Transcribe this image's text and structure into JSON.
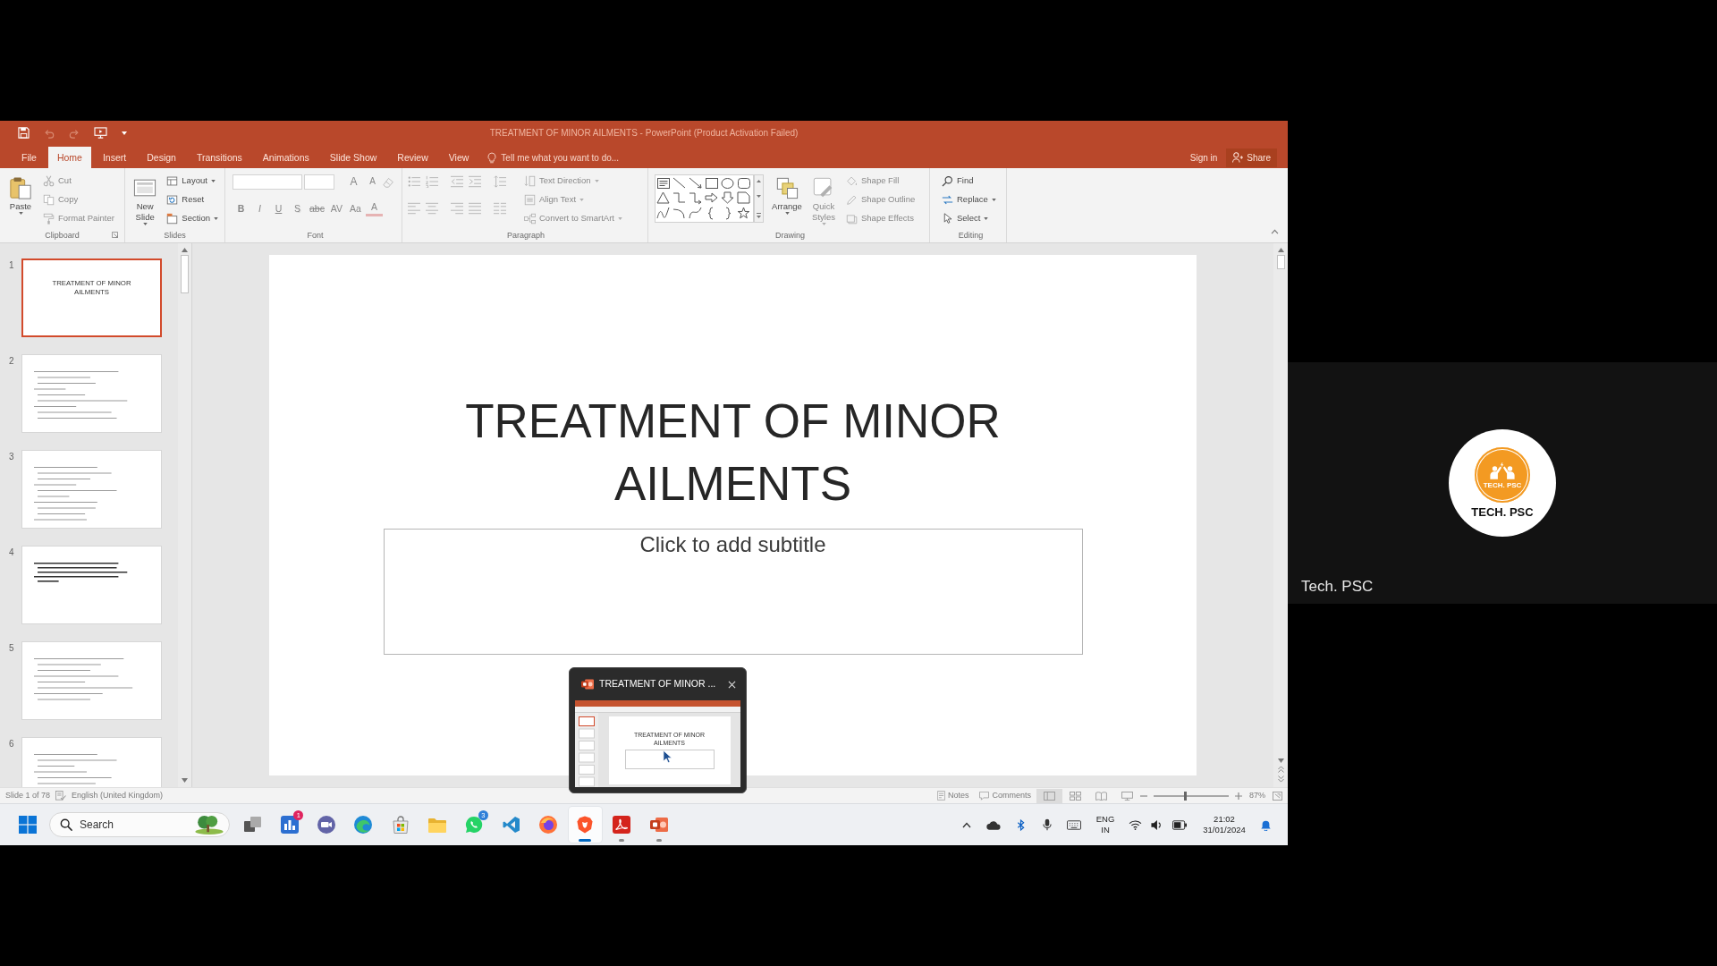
{
  "powerpoint": {
    "title_bar": {
      "title": "TREATMENT OF MINOR AILMENTS - PowerPoint (Product Activation Failed)"
    },
    "tabs": [
      {
        "label": "File",
        "selected": false
      },
      {
        "label": "Home",
        "selected": true
      },
      {
        "label": "Insert",
        "selected": false
      },
      {
        "label": "Design",
        "selected": false
      },
      {
        "label": "Transitions",
        "selected": false
      },
      {
        "label": "Animations",
        "selected": false
      },
      {
        "label": "Slide Show",
        "selected": false
      },
      {
        "label": "Review",
        "selected": false
      },
      {
        "label": "View",
        "selected": false
      }
    ],
    "tell_me": {
      "placeholder": "Tell me what you want to do..."
    },
    "account": {
      "sign_in": "Sign in",
      "share": "Share"
    },
    "ribbon": {
      "groups": [
        {
          "kind": "clipboard",
          "label": "Clipboard",
          "items": [
            {
              "kind": "large",
              "label": "Paste",
              "dropdown": true,
              "disabled": false
            },
            {
              "kind": "small",
              "label": "Cut",
              "dropdown": false,
              "disabled": true
            },
            {
              "kind": "small",
              "label": "Copy",
              "dropdown": false,
              "disabled": true
            },
            {
              "kind": "small",
              "label": "Format Painter",
              "dropdown": false,
              "disabled": true
            }
          ]
        },
        {
          "kind": "slides",
          "label": "Slides",
          "items": [
            {
              "kind": "large",
              "label": "New Slide",
              "dropdown": true,
              "disabled": false
            },
            {
              "kind": "small",
              "label": "Layout",
              "dropdown": true,
              "disabled": false
            },
            {
              "kind": "small",
              "label": "Reset",
              "dropdown": false,
              "disabled": false
            },
            {
              "kind": "small",
              "label": "Section",
              "dropdown": true,
              "disabled": false
            }
          ]
        },
        {
          "kind": "font",
          "label": "Font",
          "items": [
            {
              "kind": "font_row",
              "glyphs": [
                "A",
                "A"
              ],
              "disabled": true
            },
            {
              "kind": "format_row",
              "glyphs": [
                "B",
                "I",
                "U",
                "S",
                "abc",
                "AV",
                "Aa",
                "A"
              ],
              "disabled": true
            }
          ]
        },
        {
          "kind": "paragraph",
          "label": "Paragraph",
          "items": [
            {
              "kind": "icon_rows",
              "disabled": true
            },
            {
              "kind": "small",
              "label": "Text Direction",
              "dropdown": true,
              "disabled": true
            },
            {
              "kind": "small",
              "label": "Align Text",
              "dropdown": true,
              "disabled": true
            },
            {
              "kind": "small",
              "label": "Convert to SmartArt",
              "dropdown": true,
              "disabled": true
            }
          ]
        },
        {
          "kind": "drawing",
          "label": "Drawing",
          "items": [
            {
              "kind": "gallery"
            },
            {
              "kind": "large",
              "label": "Arrange",
              "dropdown": true,
              "disabled": false
            },
            {
              "kind": "large",
              "label": "Quick Styles",
              "dropdown": true,
              "disabled": true
            },
            {
              "kind": "small",
              "label": "Shape Fill",
              "dropdown": false,
              "disabled": true
            },
            {
              "kind": "small",
              "label": "Shape Outline",
              "dropdown": false,
              "disabled": true
            },
            {
              "kind": "small",
              "label": "Shape Effects",
              "dropdown": false,
              "disabled": true
            }
          ]
        },
        {
          "kind": "editing",
          "label": "Editing",
          "items": [
            {
              "kind": "small",
              "label": "Find",
              "dropdown": false,
              "disabled": false
            },
            {
              "kind": "small",
              "label": "Replace",
              "dropdown": true,
              "disabled": false
            },
            {
              "kind": "small",
              "label": "Select",
              "dropdown": true,
              "disabled": false
            }
          ]
        }
      ]
    },
    "slides": [
      {
        "number": "1",
        "kind": "title",
        "title": "TREATMENT OF MINOR AILMENTS",
        "selected": true
      },
      {
        "number": "2",
        "kind": "bullets",
        "selected": false
      },
      {
        "number": "3",
        "kind": "bullets",
        "selected": false
      },
      {
        "number": "4",
        "kind": "bullets",
        "selected": false
      },
      {
        "number": "5",
        "kind": "bullets",
        "selected": false
      },
      {
        "number": "6",
        "kind": "bullets",
        "selected": false
      }
    ],
    "slide": {
      "title": "TREATMENT OF MINOR AILMENTS",
      "subtitle": {
        "placeholder": "Click to add subtitle"
      }
    },
    "status_bar": {
      "slide_position": "Slide 1 of 78",
      "language": "English (United Kingdom)",
      "notes": "Notes",
      "comments": "Comments",
      "views": [
        {
          "selected": true
        },
        {
          "selected": false
        },
        {
          "selected": false
        },
        {
          "selected": false
        }
      ],
      "zoom": {
        "value": "87%",
        "level": 0.42
      }
    }
  },
  "taskbar_preview": {
    "title": "TREATMENT OF MINOR ...",
    "slide_title": "TREATMENT OF MINOR AILMENTS"
  },
  "taskbar": {
    "search": {
      "placeholder": "Search"
    },
    "apps": [
      {
        "active": false,
        "running": false
      },
      {
        "active": false,
        "running": false,
        "badge": {
          "text": "1",
          "color": "#e0245e"
        }
      },
      {
        "active": false,
        "running": false
      },
      {
        "active": false,
        "running": false
      },
      {
        "active": false,
        "running": false
      },
      {
        "active": false,
        "running": false
      },
      {
        "active": false,
        "running": false,
        "badge": {
          "text": "3",
          "color": "#2f7fd8"
        }
      },
      {
        "active": false,
        "running": false
      },
      {
        "active": false,
        "running": false
      },
      {
        "active": true,
        "running": true
      },
      {
        "active": false,
        "running": true
      },
      {
        "active": false,
        "running": true
      }
    ],
    "language": {
      "code": "ENG",
      "region": "IN"
    },
    "clock": {
      "time": "21:02",
      "date": "31/01/2024"
    }
  },
  "participant": {
    "name": "Tech. PSC",
    "logo_text": "TECH. PSC",
    "caption": "TECH. PSC"
  }
}
